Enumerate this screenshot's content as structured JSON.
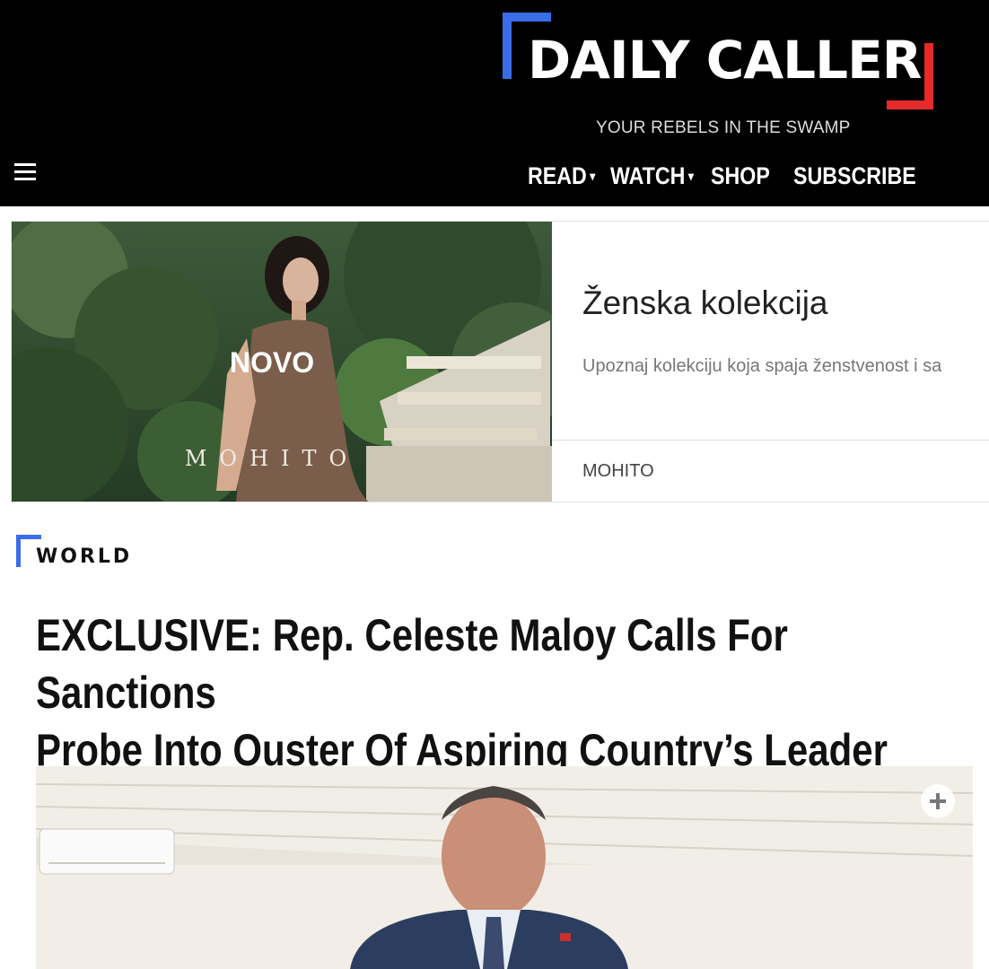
{
  "header": {
    "logo_text": "DAILY CALLER",
    "tagline": "YOUR REBELS IN THE SWAMP",
    "nav": [
      {
        "label": "READ",
        "has_dropdown": true
      },
      {
        "label": "WATCH",
        "has_dropdown": true
      },
      {
        "label": "SHOP",
        "has_dropdown": false
      },
      {
        "label": "SUBSCRIBE",
        "has_dropdown": false
      }
    ],
    "menu_icon": "hamburger-menu-icon",
    "colors": {
      "background": "#000000",
      "bracket_blue": "#3a6ee8",
      "bracket_red": "#e52b2b"
    }
  },
  "ad": {
    "image_overlay_text": "NOVO",
    "image_watermark": "MOHITO",
    "title": "Ženska kolekcija",
    "description": "Upoznaj kolekciju koja spaja ženstvenost i sa",
    "brand": "MOHITO"
  },
  "article": {
    "section": "WORLD",
    "headline_line1": "EXCLUSIVE: Rep. Celeste Maloy Calls For Sanctions",
    "headline_line2": "Probe Into Ouster Of Aspiring Country’s Leader",
    "expand_icon": "plus-circle-icon"
  }
}
